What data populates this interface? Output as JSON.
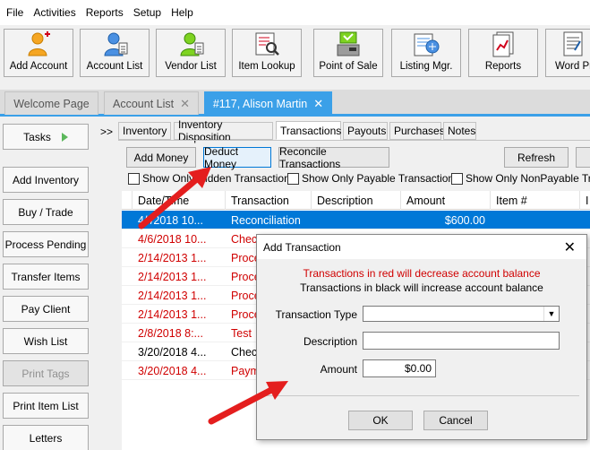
{
  "menu": [
    "File",
    "Activities",
    "Reports",
    "Setup",
    "Help"
  ],
  "toolbar": [
    {
      "label": "Add Account",
      "icon": "add-account-icon"
    },
    {
      "label": "Account List",
      "icon": "account-list-icon"
    },
    {
      "label": "Vendor List",
      "icon": "vendor-list-icon"
    },
    {
      "label": "Item Lookup",
      "icon": "item-lookup-icon"
    },
    {
      "label": "Point of Sale",
      "icon": "point-of-sale-icon"
    },
    {
      "label": "Listing Mgr.",
      "icon": "listing-manager-icon"
    },
    {
      "label": "Reports",
      "icon": "reports-icon"
    },
    {
      "label": "Word Pr",
      "icon": "word-processor-icon"
    }
  ],
  "tabs": [
    {
      "label": "Welcome Page"
    },
    {
      "label": "Account List"
    },
    {
      "label": "#117, Alison Martin"
    }
  ],
  "sidebar": {
    "tasks": "Tasks",
    "buttons": [
      "Add Inventory",
      "Buy / Trade",
      "Process Pending",
      "Transfer Items",
      "Pay Client",
      "Wish List",
      "Print Tags",
      "Print Item List",
      "Letters"
    ]
  },
  "collapse_label": ">>",
  "subtabs": [
    "Inventory",
    "Inventory Disposition",
    "Transactions",
    "Payouts",
    "Purchases",
    "Notes"
  ],
  "actions": {
    "add_money": "Add Money",
    "deduct_money": "Deduct Money",
    "reconcile": "Reconcile Transactions",
    "refresh": "Refresh"
  },
  "checkboxes": [
    "Show Only Hidden Transactions",
    "Show Only Payable Transactions",
    "Show Only NonPayable Trans"
  ],
  "grid": {
    "columns": [
      "Date/Time",
      "Transaction",
      "Description",
      "Amount",
      "Item #",
      "I"
    ],
    "rows": [
      {
        "date": "4/  /2018 10...",
        "transaction": "Reconciliation",
        "description": "",
        "amount": "$600.00",
        "style": "selected"
      },
      {
        "date": "4/6/2018 10...",
        "transaction": "Check",
        "description": "",
        "amount": "",
        "style": "red"
      },
      {
        "date": "2/14/2013 1...",
        "transaction": "Proce",
        "description": "",
        "amount": "",
        "style": "red"
      },
      {
        "date": "2/14/2013 1...",
        "transaction": "Proce",
        "description": "",
        "amount": "",
        "style": "red"
      },
      {
        "date": "2/14/2013 1...",
        "transaction": "Proce",
        "description": "",
        "amount": "",
        "style": "red"
      },
      {
        "date": "2/14/2013 1...",
        "transaction": "Proce",
        "description": "",
        "amount": "",
        "style": "red"
      },
      {
        "date": "2/8/2018 8:...",
        "transaction": "Test",
        "description": "",
        "amount": "",
        "style": "red"
      },
      {
        "date": "3/20/2018 4...",
        "transaction": "Chec",
        "description": "",
        "amount": "",
        "style": "black"
      },
      {
        "date": "3/20/2018 4...",
        "transaction": "Paym",
        "description": "",
        "amount": "",
        "style": "red"
      }
    ]
  },
  "dialog": {
    "title": "Add Transaction",
    "msg_red": "Transactions in red will decrease account balance",
    "msg_black": "Transactions in black will increase account balance",
    "type_label": "Transaction Type",
    "description_label": "Description",
    "amount_label": "Amount",
    "amount_value": "$0.00",
    "ok": "OK",
    "cancel": "Cancel"
  },
  "colors": {
    "accent_blue": "#3ba0e8",
    "selection_blue": "#0078d7",
    "debit_red": "#d00000",
    "annotation_arrow": "#e41e1e"
  }
}
